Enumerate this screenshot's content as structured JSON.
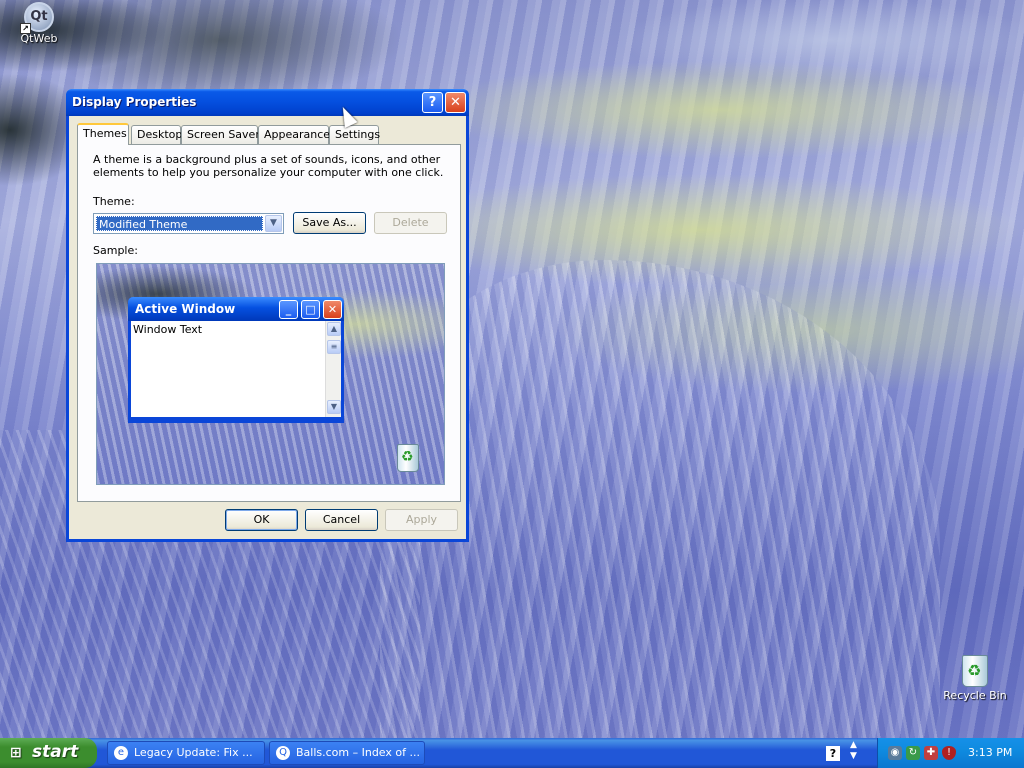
{
  "desktop": {
    "icons": [
      {
        "label": "QtWeb"
      },
      {
        "label": "Recycle Bin"
      }
    ]
  },
  "dialog": {
    "title": "Display Properties",
    "help_glyph": "?",
    "close_glyph": "✕",
    "tabs": [
      {
        "label": "Themes",
        "active": true
      },
      {
        "label": "Desktop"
      },
      {
        "label": "Screen Saver"
      },
      {
        "label": "Appearance"
      },
      {
        "label": "Settings"
      }
    ],
    "intro_text": "A theme is a background plus a set of sounds, icons, and other elements to help you personalize your computer with one click.",
    "theme_label": "Theme:",
    "theme_value": "Modified Theme",
    "save_as_label": "Save As...",
    "delete_label": "Delete",
    "sample_label": "Sample:",
    "sample_window": {
      "title": "Active Window",
      "body_text": "Window Text"
    },
    "ok_label": "OK",
    "cancel_label": "Cancel",
    "apply_label": "Apply"
  },
  "taskbar": {
    "start_label": "start",
    "tasks": [
      {
        "label": "Legacy Update: Fix ..."
      },
      {
        "label": "Balls.com – Index of ..."
      }
    ],
    "help_glyph": "?",
    "clock": "3:13 PM"
  },
  "colors": {
    "title_blue": "#0550e0",
    "start_green": "#3c8d2e",
    "dialog_face": "#ece9d8",
    "selection": "#316ac5"
  }
}
